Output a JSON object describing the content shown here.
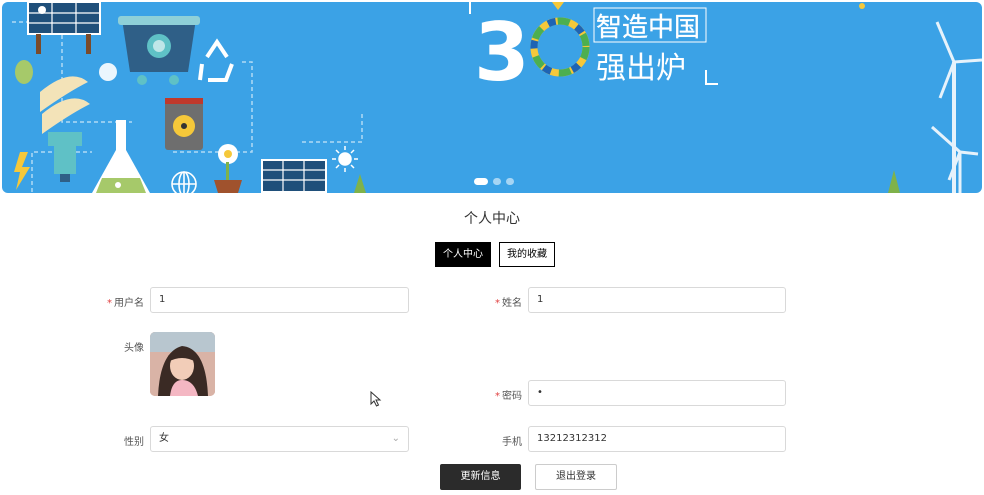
{
  "banner": {
    "big_number": "30",
    "slogan_line1": "智造中国",
    "slogan_line2": "强出炉",
    "bg_color": "#3ba2e6",
    "slides": [
      {
        "active": true
      },
      {
        "active": false
      },
      {
        "active": false
      }
    ]
  },
  "page": {
    "title": "个人中心"
  },
  "tabs": [
    {
      "label": "个人中心",
      "active": true
    },
    {
      "label": "我的收藏",
      "active": false
    }
  ],
  "form": {
    "username": {
      "label": "用户名",
      "required": true,
      "value": "1"
    },
    "name": {
      "label": "姓名",
      "required": true,
      "value": "1"
    },
    "avatar": {
      "label": "头像"
    },
    "password": {
      "label": "密码",
      "required": true,
      "value": "•"
    },
    "gender": {
      "label": "性别",
      "required": false,
      "value": "女"
    },
    "phone": {
      "label": "手机",
      "required": false,
      "value": "13212312312"
    }
  },
  "actions": {
    "update_label": "更新信息",
    "logout_label": "退出登录"
  }
}
